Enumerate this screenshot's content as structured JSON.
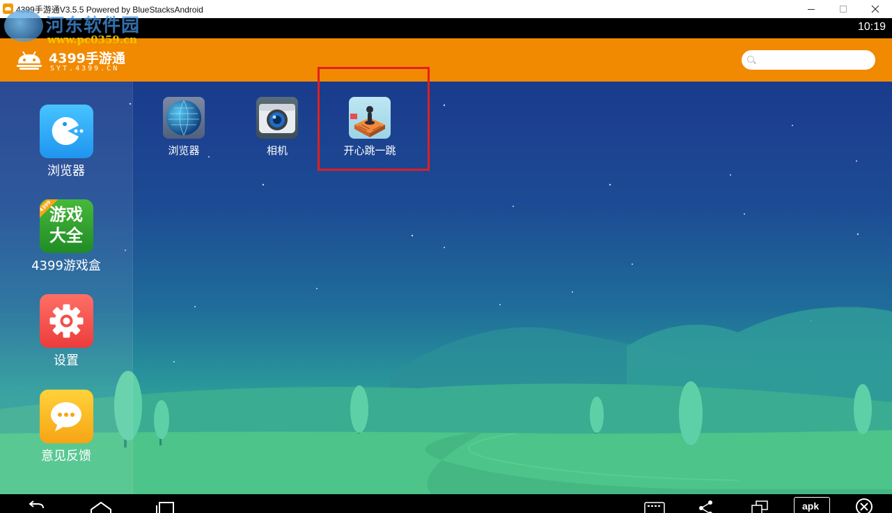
{
  "window": {
    "title": "4399手游通V3.5.5 Powered by BlueStacksAndroid"
  },
  "watermark": {
    "text": "河东软件园",
    "url": "www.pc0359.cn"
  },
  "statusbar": {
    "time": "10:19"
  },
  "header": {
    "brand_name": "4399手游通",
    "brand_sub": "SYT.4399.CN",
    "search_placeholder": ""
  },
  "sidebar": {
    "items": [
      {
        "label": "浏览器",
        "icon": "pacman-icon"
      },
      {
        "label": "4399游戏盒",
        "icon": "game-box-icon",
        "tile_text_1": "游戏",
        "tile_text_2": "大全",
        "badge": "4399"
      },
      {
        "label": "设置",
        "icon": "gear-icon"
      },
      {
        "label": "意见反馈",
        "icon": "chat-bubble-icon"
      }
    ]
  },
  "apps": [
    {
      "label": "浏览器",
      "icon": "globe-icon"
    },
    {
      "label": "相机",
      "icon": "camera-icon"
    },
    {
      "label": "开心跳一跳",
      "icon": "jump-game-icon"
    }
  ],
  "navbar": {
    "buttons": [
      "back-icon",
      "home-icon",
      "recents-icon",
      "keyboard-icon",
      "share-icon",
      "window-icon",
      "apk-icon",
      "close-circle-icon"
    ],
    "apk_label": "apk"
  },
  "colors": {
    "header": "#f18a00",
    "highlight": "#e21f1f"
  }
}
